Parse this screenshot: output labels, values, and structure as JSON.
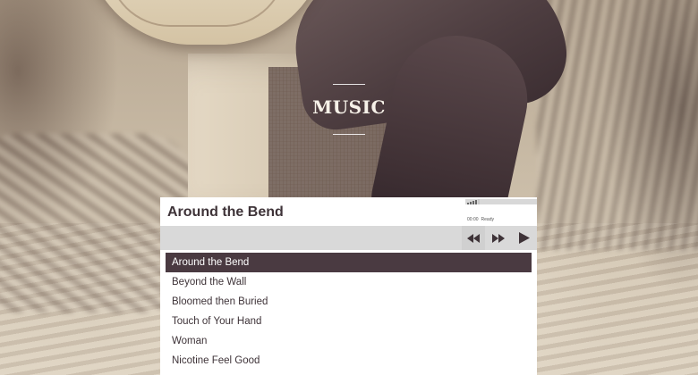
{
  "section": {
    "title": "MUSIC"
  },
  "player": {
    "now_playing": "Around the Bend",
    "elapsed": "00:00",
    "status": "Ready",
    "progress_fraction": 0,
    "volume_level_fraction": 0.8,
    "accent_color": "#4a3a41",
    "controls": {
      "previous_icon": "rewind-icon",
      "next_icon": "fast-forward-icon",
      "play_icon": "play-icon"
    }
  },
  "playlist": {
    "active_index": 0,
    "tracks": [
      "Around the Bend",
      "Beyond the Wall",
      "Bloomed then Buried",
      "Touch of Your Hand",
      "Woman",
      "Nicotine Feel Good"
    ]
  }
}
